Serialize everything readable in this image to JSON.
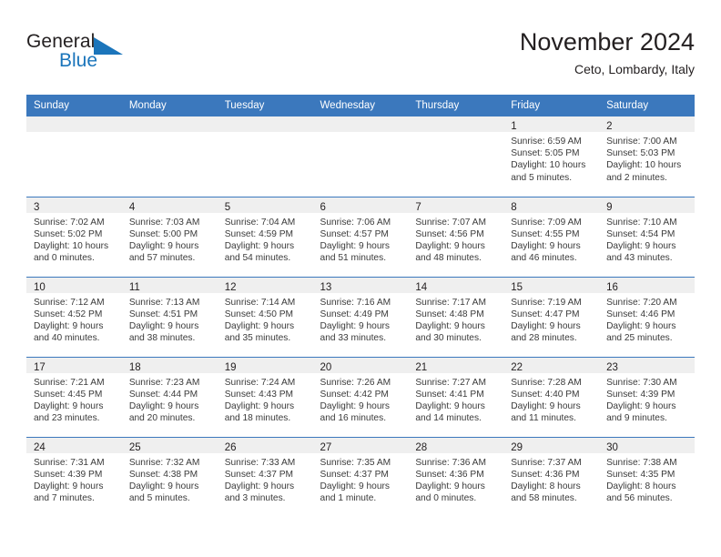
{
  "brand": {
    "line1": "General",
    "line2": "Blue",
    "triangle_icon": "triangle-icon",
    "colors": {
      "text": "#231f20",
      "blue": "#1b75bb"
    }
  },
  "header": {
    "title": "November 2024",
    "subtitle": "Ceto, Lombardy, Italy"
  },
  "theme": {
    "header_blue": "#3b78bd",
    "band_gray": "#efefef",
    "text": "#231f20"
  },
  "weekdays": [
    "Sunday",
    "Monday",
    "Tuesday",
    "Wednesday",
    "Thursday",
    "Friday",
    "Saturday"
  ],
  "weeks": [
    [
      {
        "empty": true
      },
      {
        "empty": true
      },
      {
        "empty": true
      },
      {
        "empty": true
      },
      {
        "empty": true
      },
      {
        "day": "1",
        "sunrise": "Sunrise: 6:59 AM",
        "sunset": "Sunset: 5:05 PM",
        "daylight1": "Daylight: 10 hours",
        "daylight2": "and 5 minutes."
      },
      {
        "day": "2",
        "sunrise": "Sunrise: 7:00 AM",
        "sunset": "Sunset: 5:03 PM",
        "daylight1": "Daylight: 10 hours",
        "daylight2": "and 2 minutes."
      }
    ],
    [
      {
        "day": "3",
        "sunrise": "Sunrise: 7:02 AM",
        "sunset": "Sunset: 5:02 PM",
        "daylight1": "Daylight: 10 hours",
        "daylight2": "and 0 minutes."
      },
      {
        "day": "4",
        "sunrise": "Sunrise: 7:03 AM",
        "sunset": "Sunset: 5:00 PM",
        "daylight1": "Daylight: 9 hours",
        "daylight2": "and 57 minutes."
      },
      {
        "day": "5",
        "sunrise": "Sunrise: 7:04 AM",
        "sunset": "Sunset: 4:59 PM",
        "daylight1": "Daylight: 9 hours",
        "daylight2": "and 54 minutes."
      },
      {
        "day": "6",
        "sunrise": "Sunrise: 7:06 AM",
        "sunset": "Sunset: 4:57 PM",
        "daylight1": "Daylight: 9 hours",
        "daylight2": "and 51 minutes."
      },
      {
        "day": "7",
        "sunrise": "Sunrise: 7:07 AM",
        "sunset": "Sunset: 4:56 PM",
        "daylight1": "Daylight: 9 hours",
        "daylight2": "and 48 minutes."
      },
      {
        "day": "8",
        "sunrise": "Sunrise: 7:09 AM",
        "sunset": "Sunset: 4:55 PM",
        "daylight1": "Daylight: 9 hours",
        "daylight2": "and 46 minutes."
      },
      {
        "day": "9",
        "sunrise": "Sunrise: 7:10 AM",
        "sunset": "Sunset: 4:54 PM",
        "daylight1": "Daylight: 9 hours",
        "daylight2": "and 43 minutes."
      }
    ],
    [
      {
        "day": "10",
        "sunrise": "Sunrise: 7:12 AM",
        "sunset": "Sunset: 4:52 PM",
        "daylight1": "Daylight: 9 hours",
        "daylight2": "and 40 minutes."
      },
      {
        "day": "11",
        "sunrise": "Sunrise: 7:13 AM",
        "sunset": "Sunset: 4:51 PM",
        "daylight1": "Daylight: 9 hours",
        "daylight2": "and 38 minutes."
      },
      {
        "day": "12",
        "sunrise": "Sunrise: 7:14 AM",
        "sunset": "Sunset: 4:50 PM",
        "daylight1": "Daylight: 9 hours",
        "daylight2": "and 35 minutes."
      },
      {
        "day": "13",
        "sunrise": "Sunrise: 7:16 AM",
        "sunset": "Sunset: 4:49 PM",
        "daylight1": "Daylight: 9 hours",
        "daylight2": "and 33 minutes."
      },
      {
        "day": "14",
        "sunrise": "Sunrise: 7:17 AM",
        "sunset": "Sunset: 4:48 PM",
        "daylight1": "Daylight: 9 hours",
        "daylight2": "and 30 minutes."
      },
      {
        "day": "15",
        "sunrise": "Sunrise: 7:19 AM",
        "sunset": "Sunset: 4:47 PM",
        "daylight1": "Daylight: 9 hours",
        "daylight2": "and 28 minutes."
      },
      {
        "day": "16",
        "sunrise": "Sunrise: 7:20 AM",
        "sunset": "Sunset: 4:46 PM",
        "daylight1": "Daylight: 9 hours",
        "daylight2": "and 25 minutes."
      }
    ],
    [
      {
        "day": "17",
        "sunrise": "Sunrise: 7:21 AM",
        "sunset": "Sunset: 4:45 PM",
        "daylight1": "Daylight: 9 hours",
        "daylight2": "and 23 minutes."
      },
      {
        "day": "18",
        "sunrise": "Sunrise: 7:23 AM",
        "sunset": "Sunset: 4:44 PM",
        "daylight1": "Daylight: 9 hours",
        "daylight2": "and 20 minutes."
      },
      {
        "day": "19",
        "sunrise": "Sunrise: 7:24 AM",
        "sunset": "Sunset: 4:43 PM",
        "daylight1": "Daylight: 9 hours",
        "daylight2": "and 18 minutes."
      },
      {
        "day": "20",
        "sunrise": "Sunrise: 7:26 AM",
        "sunset": "Sunset: 4:42 PM",
        "daylight1": "Daylight: 9 hours",
        "daylight2": "and 16 minutes."
      },
      {
        "day": "21",
        "sunrise": "Sunrise: 7:27 AM",
        "sunset": "Sunset: 4:41 PM",
        "daylight1": "Daylight: 9 hours",
        "daylight2": "and 14 minutes."
      },
      {
        "day": "22",
        "sunrise": "Sunrise: 7:28 AM",
        "sunset": "Sunset: 4:40 PM",
        "daylight1": "Daylight: 9 hours",
        "daylight2": "and 11 minutes."
      },
      {
        "day": "23",
        "sunrise": "Sunrise: 7:30 AM",
        "sunset": "Sunset: 4:39 PM",
        "daylight1": "Daylight: 9 hours",
        "daylight2": "and 9 minutes."
      }
    ],
    [
      {
        "day": "24",
        "sunrise": "Sunrise: 7:31 AM",
        "sunset": "Sunset: 4:39 PM",
        "daylight1": "Daylight: 9 hours",
        "daylight2": "and 7 minutes."
      },
      {
        "day": "25",
        "sunrise": "Sunrise: 7:32 AM",
        "sunset": "Sunset: 4:38 PM",
        "daylight1": "Daylight: 9 hours",
        "daylight2": "and 5 minutes."
      },
      {
        "day": "26",
        "sunrise": "Sunrise: 7:33 AM",
        "sunset": "Sunset: 4:37 PM",
        "daylight1": "Daylight: 9 hours",
        "daylight2": "and 3 minutes."
      },
      {
        "day": "27",
        "sunrise": "Sunrise: 7:35 AM",
        "sunset": "Sunset: 4:37 PM",
        "daylight1": "Daylight: 9 hours",
        "daylight2": "and 1 minute."
      },
      {
        "day": "28",
        "sunrise": "Sunrise: 7:36 AM",
        "sunset": "Sunset: 4:36 PM",
        "daylight1": "Daylight: 9 hours",
        "daylight2": "and 0 minutes."
      },
      {
        "day": "29",
        "sunrise": "Sunrise: 7:37 AM",
        "sunset": "Sunset: 4:36 PM",
        "daylight1": "Daylight: 8 hours",
        "daylight2": "and 58 minutes."
      },
      {
        "day": "30",
        "sunrise": "Sunrise: 7:38 AM",
        "sunset": "Sunset: 4:35 PM",
        "daylight1": "Daylight: 8 hours",
        "daylight2": "and 56 minutes."
      }
    ]
  ]
}
